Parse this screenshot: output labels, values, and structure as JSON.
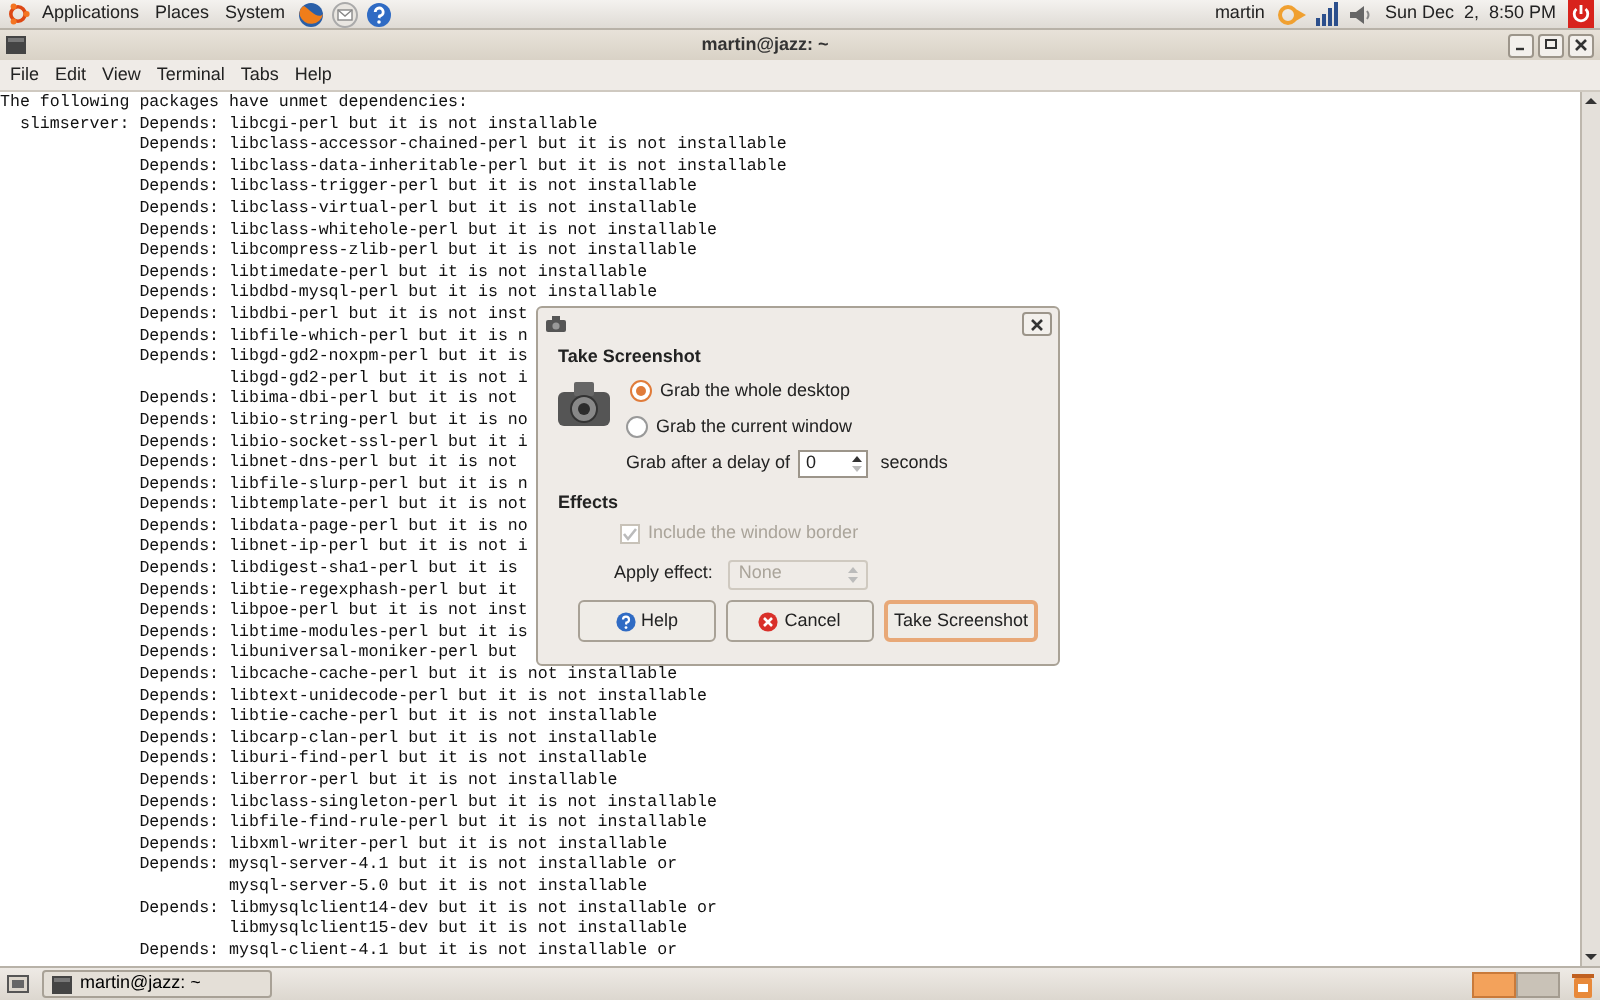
{
  "top_panel": {
    "menus": [
      "Applications",
      "Places",
      "System"
    ],
    "user": "martin",
    "clock": "Sun Dec  2,  8:50 PM"
  },
  "window": {
    "title": "martin@jazz: ~",
    "menu": [
      "File",
      "Edit",
      "View",
      "Terminal",
      "Tabs",
      "Help"
    ]
  },
  "terminal": {
    "lines": [
      "The following packages have unmet dependencies:",
      "  slimserver: Depends: libcgi-perl but it is not installable",
      "              Depends: libclass-accessor-chained-perl but it is not installable",
      "              Depends: libclass-data-inheritable-perl but it is not installable",
      "              Depends: libclass-trigger-perl but it is not installable",
      "              Depends: libclass-virtual-perl but it is not installable",
      "              Depends: libclass-whitehole-perl but it is not installable",
      "              Depends: libcompress-zlib-perl but it is not installable",
      "              Depends: libtimedate-perl but it is not installable",
      "              Depends: libdbd-mysql-perl but it is not installable",
      "              Depends: libdbi-perl but it is not inst",
      "              Depends: libfile-which-perl but it is n",
      "              Depends: libgd-gd2-noxpm-perl but it is",
      "                       libgd-gd2-perl but it is not i",
      "              Depends: libima-dbi-perl but it is not",
      "              Depends: libio-string-perl but it is no",
      "              Depends: libio-socket-ssl-perl but it i",
      "              Depends: libnet-dns-perl but it is not",
      "              Depends: libfile-slurp-perl but it is n",
      "              Depends: libtemplate-perl but it is not",
      "              Depends: libdata-page-perl but it is no",
      "              Depends: libnet-ip-perl but it is not i",
      "              Depends: libdigest-sha1-perl but it is",
      "              Depends: libtie-regexphash-perl but it",
      "              Depends: libpoe-perl but it is not inst",
      "              Depends: libtime-modules-perl but it is",
      "              Depends: libuniversal-moniker-perl but",
      "              Depends: libcache-cache-perl but it is not installable",
      "              Depends: libtext-unidecode-perl but it is not installable",
      "              Depends: libtie-cache-perl but it is not installable",
      "              Depends: libcarp-clan-perl but it is not installable",
      "              Depends: liburi-find-perl but it is not installable",
      "              Depends: liberror-perl but it is not installable",
      "              Depends: libclass-singleton-perl but it is not installable",
      "              Depends: libfile-find-rule-perl but it is not installable",
      "              Depends: libxml-writer-perl but it is not installable",
      "              Depends: mysql-server-4.1 but it is not installable or",
      "                       mysql-server-5.0 but it is not installable",
      "              Depends: libmysqlclient14-dev but it is not installable or",
      "                       libmysqlclient15-dev but it is not installable",
      "              Depends: mysql-client-4.1 but it is not installable or"
    ]
  },
  "dialog": {
    "heading": "Take Screenshot",
    "options": [
      {
        "label": "Grab the whole desktop",
        "selected": true
      },
      {
        "label": "Grab the current window",
        "selected": false
      }
    ],
    "delay": {
      "label": "Grab after a delay of",
      "value": "0",
      "unit": "seconds"
    },
    "effects": {
      "heading": "Effects",
      "border": {
        "label": "Include the window border",
        "checked": true,
        "disabled": true
      },
      "apply": {
        "label": "Apply effect:",
        "value": "None",
        "disabled": true
      }
    },
    "buttons": [
      {
        "label": "Help",
        "kind": "help"
      },
      {
        "label": "Cancel",
        "kind": "cancel"
      },
      {
        "label": "Take Screenshot",
        "kind": "default"
      }
    ]
  },
  "taskbar": {
    "tasks": [
      {
        "label": "martin@jazz: ~"
      }
    ]
  }
}
